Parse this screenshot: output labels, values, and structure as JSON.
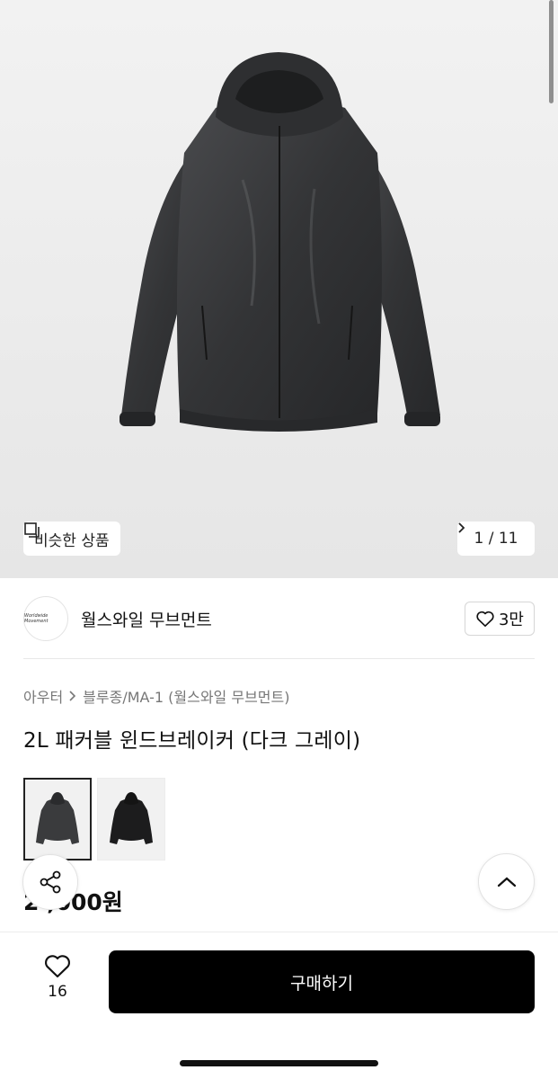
{
  "hero": {
    "similar_label": "비슷한 상품",
    "counter": "1 / 11"
  },
  "seller": {
    "name": "월스와일 무브먼트",
    "logo_text": "Worldwide Movement",
    "follow_count": "3만"
  },
  "product": {
    "breadcrumb": [
      "아우터",
      "블루종/MA-1 (월스와일 무브먼트)"
    ],
    "title": "2L 패커블 윈드브레이커 (다크 그레이)",
    "price": "2 ,000원",
    "variants": [
      "dark-gray",
      "black"
    ]
  },
  "bottom": {
    "like_count": "16",
    "buy_label": "구매하기"
  },
  "colors": {
    "button_black": "#000000",
    "jacket_dark_gray": "#3a3b3d",
    "jacket_black": "#1c1c1d"
  }
}
